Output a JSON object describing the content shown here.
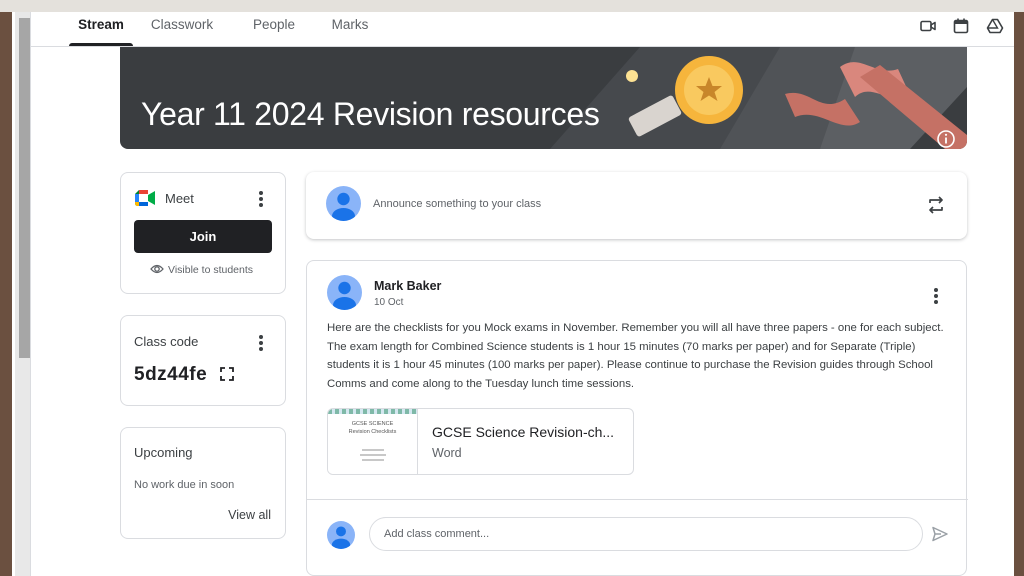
{
  "tabs": [
    {
      "label": "Stream"
    },
    {
      "label": "Classwork"
    },
    {
      "label": "People"
    },
    {
      "label": "Marks"
    }
  ],
  "top_icons": [
    "video-camera-icon",
    "calendar-icon",
    "google-drive-icon"
  ],
  "banner": {
    "title": "Year 11 2024 Revision resources",
    "info_icon": "info-icon"
  },
  "meet": {
    "label": "Meet",
    "join_label": "Join",
    "visibility": "Visible to students"
  },
  "class_code": {
    "label": "Class code",
    "code": "5dz44fe"
  },
  "upcoming": {
    "title": "Upcoming",
    "empty_text": "No work due in soon",
    "view_all": "View all"
  },
  "announce": {
    "placeholder": "Announce something to your class"
  },
  "post": {
    "author": "Mark Baker",
    "date": "10 Oct",
    "body": "Here are the checklists for you Mock exams in November.  Remember you will all have three papers - one for each subject.  The exam length for Combined Science students is 1 hour 15 minutes (70 marks per paper) and for Separate (Triple) students it is 1 hour 45 minutes (100 marks per paper).  Please continue to purchase the Revision guides through School Comms and come along to the Tuesday lunch time sessions.",
    "attachment": {
      "title": "GCSE Science Revision-ch...",
      "type": "Word",
      "thumb_heading": "GCSE SCIENCE",
      "thumb_subheading": "Revision Checklists"
    },
    "comment_placeholder": "Add class comment..."
  },
  "colors": {
    "banner_bg": "#3a3d40",
    "avatar": "#8ab4f8",
    "join_button": "#202124"
  }
}
